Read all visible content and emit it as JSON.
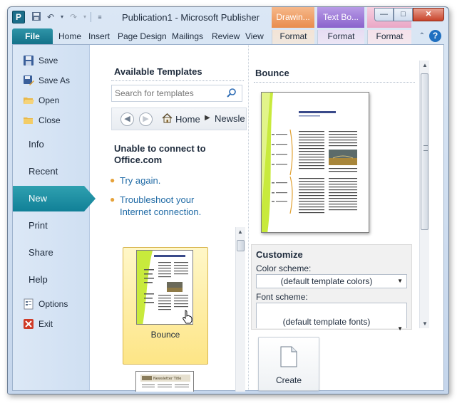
{
  "window": {
    "app_icon_letter": "P",
    "title": "Publication1  -  Microsoft Publisher",
    "context_headers": [
      "Drawin...",
      "Text Bo...",
      ""
    ],
    "buttons": {
      "minimize": "—",
      "maximize": "□",
      "close": "✕"
    }
  },
  "ribbon": {
    "file_tab": "File",
    "tabs": [
      "Home",
      "Insert",
      "Page Design",
      "Mailings",
      "Review",
      "View"
    ],
    "context_tabs": [
      "Format",
      "Format",
      "Format"
    ],
    "help": "?"
  },
  "backstage_nav": {
    "commands": [
      {
        "label": "Save",
        "icon": "save-icon"
      },
      {
        "label": "Save As",
        "icon": "save-as-icon"
      },
      {
        "label": "Open",
        "icon": "open-folder-icon"
      },
      {
        "label": "Close",
        "icon": "close-folder-icon"
      }
    ],
    "items": [
      "Info",
      "Recent",
      "New",
      "Print",
      "Share",
      "Help"
    ],
    "active_item": "New",
    "bottom_commands": [
      {
        "label": "Options",
        "icon": "options-icon"
      },
      {
        "label": "Exit",
        "icon": "exit-icon"
      }
    ]
  },
  "templates": {
    "title": "Available Templates",
    "search_placeholder": "Search for templates",
    "breadcrumb": {
      "home": "Home",
      "next": "Newsle"
    },
    "error_title": "Unable to connect to Office.com",
    "links": [
      "Try again.",
      "Troubleshoot your Internet connection."
    ],
    "selected_template": "Bounce",
    "newsletter_title": "Newsletter Title"
  },
  "preview": {
    "title": "Bounce",
    "customize_title": "Customize",
    "color_scheme_label": "Color scheme:",
    "color_scheme_value": "(default template colors)",
    "font_scheme_label": "Font scheme:",
    "font_scheme_value": "(default template fonts)",
    "create_label": "Create"
  },
  "colors": {
    "accent_teal": "#127088",
    "link_blue": "#1f6aa5",
    "selection_yellow": "#fde586",
    "template_green": "#c8ea3c"
  }
}
